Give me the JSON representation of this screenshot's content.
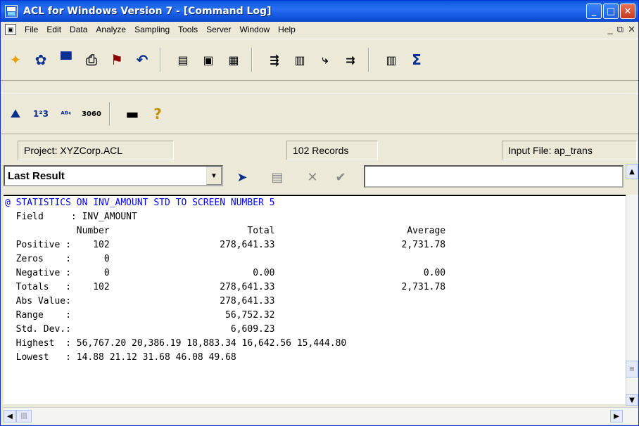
{
  "window": {
    "title": "ACL for Windows Version 7 - [Command Log]"
  },
  "menu": [
    {
      "label": "File"
    },
    {
      "label": "Edit"
    },
    {
      "label": "Data"
    },
    {
      "label": "Analyze"
    },
    {
      "label": "Sampling"
    },
    {
      "label": "Tools"
    },
    {
      "label": "Server"
    },
    {
      "label": "Window"
    },
    {
      "label": "Help"
    }
  ],
  "status": {
    "project": "Project: XYZCorp.ACL",
    "records": "102 Records",
    "input_file": "Input File: ap_trans"
  },
  "result_combo": {
    "value": "Last Result"
  },
  "log": {
    "command": "@ STATISTICS ON INV_AMOUNT STD TO SCREEN NUMBER 5",
    "lines": [
      "  Field     : INV_AMOUNT",
      "             Number                         Total                        Average",
      "  Positive :    102                    278,641.33                       2,731.78",
      "  Zeros    :      0",
      "  Negative :      0                          0.00                           0.00",
      "  Totals   :    102                    278,641.33                       2,731.78",
      "  Abs Value:                           278,641.33",
      "  Range    :                            56,752.32",
      "  Std. Dev.:                             6,609.23",
      "  Highest  : 56,767.20 20,386.19 18,883.34 16,642.56 15,444.80",
      "  Lowest   : 14.88 21.12 31.68 46.08 49.68"
    ]
  },
  "icons": {
    "toolbar1": [
      "new-project-icon",
      "open-icon",
      "save-icon",
      "print-icon",
      "bookmark-icon",
      "undo-icon",
      "table-view-icon",
      "view-icon",
      "grid-icon",
      "filter-icon",
      "index-icon",
      "relate-icon",
      "join-icon",
      "histogram-icon",
      "total-icon"
    ],
    "toolbar2": [
      "stratify-icon",
      "numeric-icon",
      "text-icon",
      "numbers-icon",
      "dash-icon",
      "help-icon"
    ]
  }
}
